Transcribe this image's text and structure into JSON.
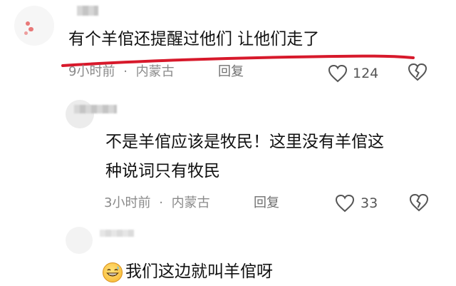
{
  "comments": [
    {
      "text": "有个羊倌还提醒过他们 让他们走了",
      "time": "9小时前",
      "location": "内蒙古",
      "reply_label": "回复",
      "likes": "124"
    },
    {
      "text_line1": "不是羊倌应该是牧民！这里没有羊倌这",
      "text_line2": "种说词只有牧民",
      "time": "3小时前",
      "location": "内蒙古",
      "reply_label": "回复",
      "likes": "33"
    },
    {
      "text": "我们这边就叫羊倌呀"
    }
  ],
  "separator": "·",
  "colors": {
    "underline": "#d7192b",
    "meta_text": "#8a8a8a",
    "comment_text": "#111111"
  },
  "icons": [
    "heart-icon",
    "dislike-icon",
    "grinning-emoji-icon"
  ]
}
